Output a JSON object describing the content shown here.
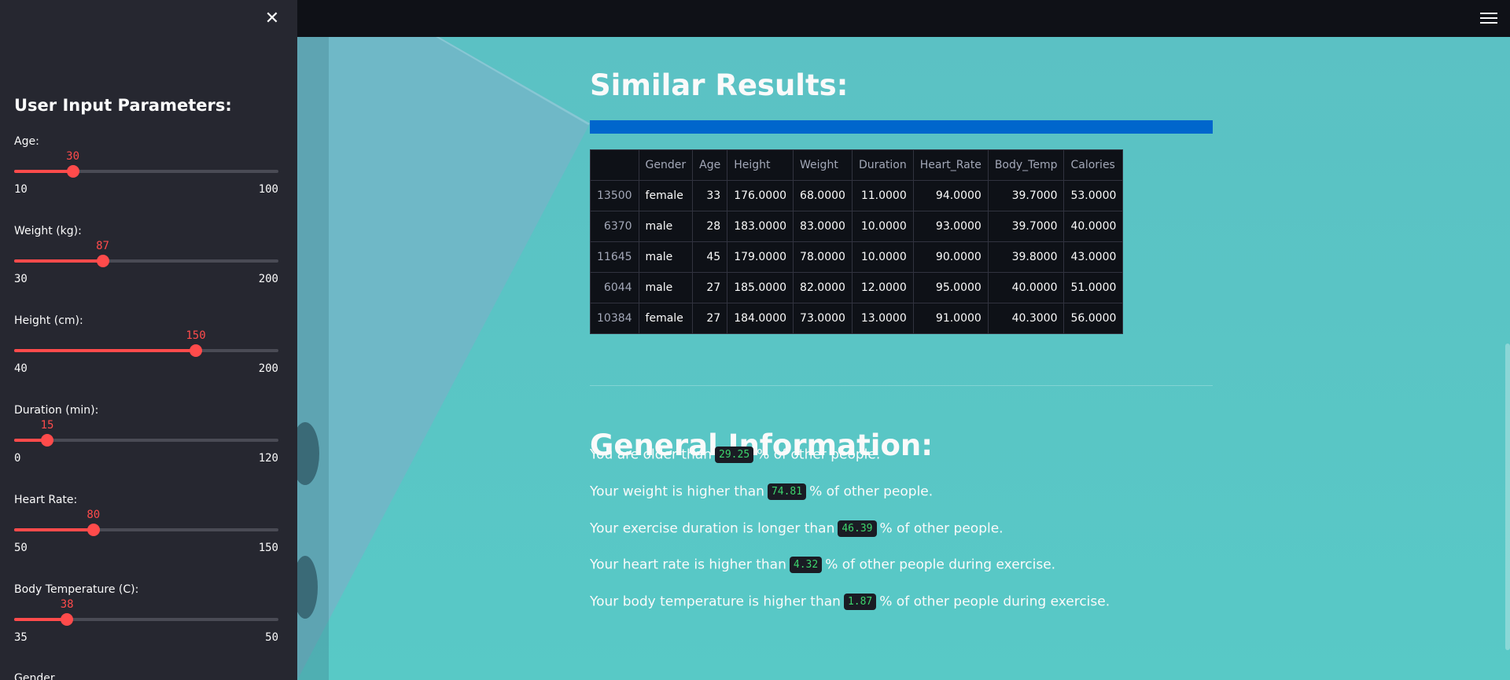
{
  "sidebar": {
    "title": "User Input Parameters:",
    "sliders": [
      {
        "label": "Age:",
        "value": "30",
        "min": "10",
        "max": "100",
        "fraction": 0.222
      },
      {
        "label": "Weight (kg):",
        "value": "87",
        "min": "30",
        "max": "200",
        "fraction": 0.335
      },
      {
        "label": "Height (cm):",
        "value": "150",
        "min": "40",
        "max": "200",
        "fraction": 0.6875
      },
      {
        "label": "Duration (min):",
        "value": "15",
        "min": "0",
        "max": "120",
        "fraction": 0.125
      },
      {
        "label": "Heart Rate:",
        "value": "80",
        "min": "50",
        "max": "150",
        "fraction": 0.3
      },
      {
        "label": "Body Temperature (C):",
        "value": "38",
        "min": "35",
        "max": "50",
        "fraction": 0.2
      }
    ],
    "next_label_partial": "Gender"
  },
  "main": {
    "similar_title": "Similar Results:",
    "table": {
      "headers": [
        "",
        "Gender",
        "Age",
        "Height",
        "Weight",
        "Duration",
        "Heart_Rate",
        "Body_Temp",
        "Calories"
      ],
      "rows": [
        [
          "13500",
          "female",
          "33",
          "176.0000",
          "68.0000",
          "11.0000",
          "94.0000",
          "39.7000",
          "53.0000"
        ],
        [
          "6370",
          "male",
          "28",
          "183.0000",
          "83.0000",
          "10.0000",
          "93.0000",
          "39.7000",
          "40.0000"
        ],
        [
          "11645",
          "male",
          "45",
          "179.0000",
          "78.0000",
          "10.0000",
          "90.0000",
          "39.8000",
          "43.0000"
        ],
        [
          "6044",
          "male",
          "27",
          "185.0000",
          "82.0000",
          "12.0000",
          "95.0000",
          "40.0000",
          "51.0000"
        ],
        [
          "10384",
          "female",
          "27",
          "184.0000",
          "73.0000",
          "13.0000",
          "91.0000",
          "40.3000",
          "56.0000"
        ]
      ]
    },
    "general_title": "General Information:",
    "info": [
      {
        "pre": "You are older than",
        "value": "29.25",
        "post": "% of other people."
      },
      {
        "pre": "Your weight is higher than",
        "value": "74.81",
        "post": "% of other people."
      },
      {
        "pre": "Your exercise duration is longer than",
        "value": "46.39",
        "post": "% of other people."
      },
      {
        "pre": "Your heart rate is higher than",
        "value": "4.32",
        "post": "% of other people during exercise."
      },
      {
        "pre": "Your body temperature is higher than",
        "value": "1.87",
        "post": "% of other people during exercise."
      }
    ]
  },
  "icons": {
    "close": "close-icon",
    "menu": "hamburger-menu-icon"
  },
  "colors": {
    "accent": "#ff4b4b",
    "sidebar_bg": "#262730",
    "progress_bar": "#0066cc",
    "code_text": "#3dd56d"
  }
}
